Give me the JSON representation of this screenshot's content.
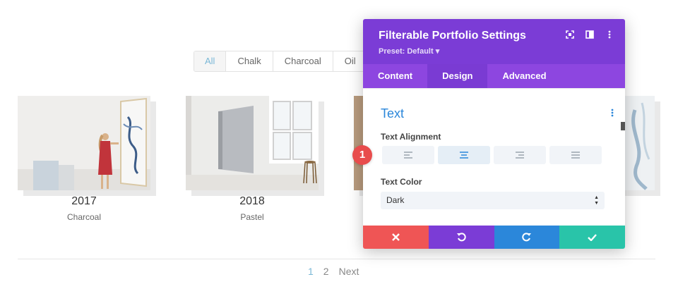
{
  "filters": [
    {
      "label": "All",
      "active": true
    },
    {
      "label": "Chalk",
      "active": false
    },
    {
      "label": "Charcoal",
      "active": false
    },
    {
      "label": "Oil",
      "active": false
    }
  ],
  "portfolio_items": [
    {
      "year": "2017",
      "category": "Charcoal",
      "image": "woman-painting-canvas"
    },
    {
      "year": "2018",
      "category": "Pastel",
      "image": "canvas-on-wall-with-chair"
    },
    {
      "image": "partial-artwork-obscured"
    },
    {
      "image": "blue-abstract-artwork"
    }
  ],
  "pagination": {
    "pages": [
      "1",
      "2"
    ],
    "current": "1",
    "next_label": "Next"
  },
  "modal": {
    "title": "Filterable Portfolio Settings",
    "preset": "Preset: Default ▾",
    "header_icons": [
      "expand-icon",
      "split-view-icon",
      "more-options-icon"
    ],
    "tabs": [
      {
        "label": "Content",
        "active": false
      },
      {
        "label": "Design",
        "active": true
      },
      {
        "label": "Advanced",
        "active": false
      }
    ],
    "section_title": "Text",
    "text_alignment_label": "Text Alignment",
    "alignment_options": [
      "left",
      "center",
      "right",
      "justify"
    ],
    "selected_alignment": "center",
    "text_color_label": "Text Color",
    "text_color_value": "Dark",
    "footer_icons": [
      "close-icon",
      "undo-icon",
      "redo-icon",
      "check-icon"
    ]
  },
  "step_badge": "1",
  "colors": {
    "modal_header": "#7b3cd6",
    "tabs_bar": "#8d46e0",
    "accent_blue": "#2b87da",
    "cancel_red": "#ef5555",
    "save_teal": "#29c4a9",
    "filter_active": "#7ab8d6"
  }
}
